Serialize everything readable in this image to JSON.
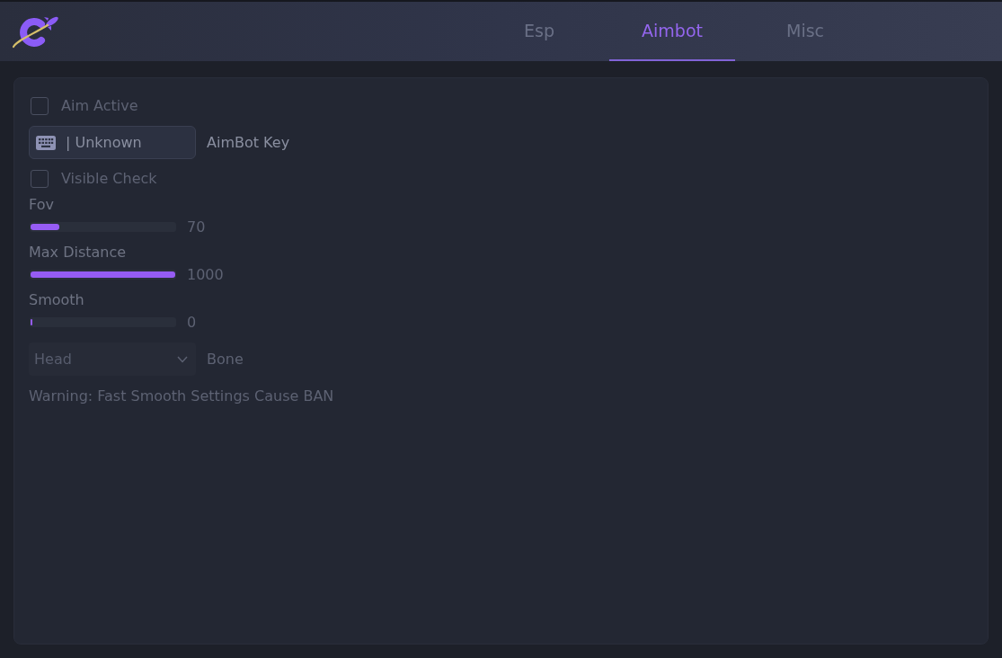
{
  "header": {
    "tabs": [
      {
        "label": "Esp",
        "selected": false
      },
      {
        "label": "Aimbot",
        "selected": true
      },
      {
        "label": "Misc",
        "selected": false
      }
    ]
  },
  "controls": [
    {
      "kind": "checkbox",
      "label": "Aim Active",
      "checked": false
    },
    {
      "kind": "keybind",
      "key": "| Unknown",
      "label": "AimBot Key"
    },
    {
      "kind": "checkbox",
      "label": "Visible Check",
      "checked": false
    },
    {
      "kind": "slider",
      "label": "Fov",
      "level": 0.2,
      "reading": "70"
    },
    {
      "kind": "slider",
      "label": "Max Distance",
      "level": 1,
      "reading": "1000"
    },
    {
      "kind": "slider",
      "label": "Smooth",
      "level": 0,
      "reading": "0"
    },
    {
      "kind": "dropdown",
      "value": "Head",
      "label": "Bone"
    },
    {
      "kind": "text",
      "text": "Warning: Fast Smooth Settings Cause BAN"
    }
  ]
}
